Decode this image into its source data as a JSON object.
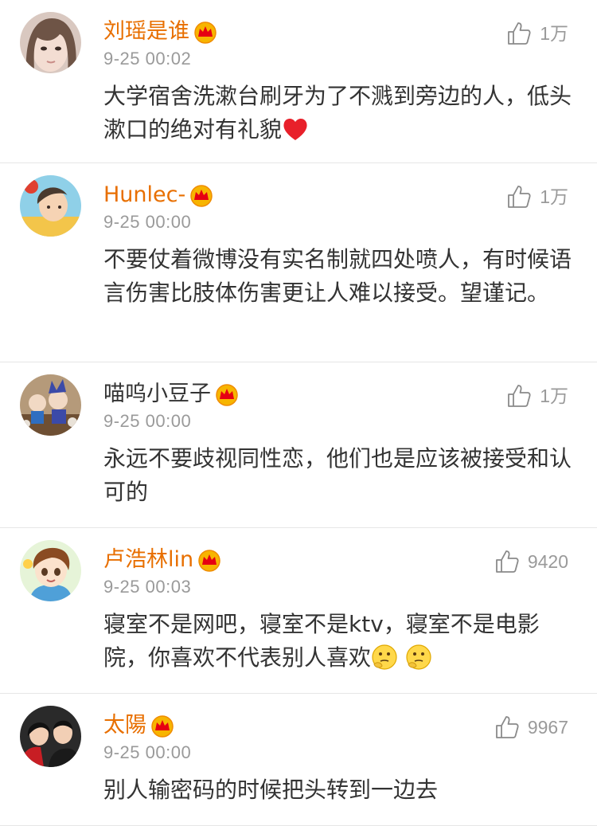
{
  "accent_username_color": "#e86f00",
  "comments": [
    {
      "username": "刘瑶是谁",
      "username_color": "#e86f00",
      "time": "9-25 00:02",
      "likes": "1万",
      "text": "大学宿舍洗漱台刷牙为了不溅到旁边的人，低头漱口的绝对有礼貌",
      "emojis": [
        "red-heart"
      ],
      "avatar": "girl-avatar"
    },
    {
      "username": "Hunlec-",
      "username_color": "#e86f00",
      "time": "9-25 00:00",
      "likes": "1万",
      "text": "不要仗着微博没有实名制就四处喷人，有时候语言伤害比肢体伤害更让人难以接受。望谨记。",
      "emojis": [],
      "avatar": "cartoon-boy-avatar"
    },
    {
      "username": "喵呜小豆子",
      "username_color": "#333333",
      "time": "9-25 00:00",
      "likes": "1万",
      "text": "永远不要歧视同性恋，他们也是应该被接受和认可的",
      "emojis": [],
      "avatar": "dolls-avatar"
    },
    {
      "username": "卢浩林lin",
      "username_color": "#e86f00",
      "time": "9-25 00:03",
      "likes": "9420",
      "text": "寝室不是网吧，寝室不是ktv，寝室不是电影院，你喜欢不代表别人喜欢",
      "emojis": [
        "thinking-face",
        "thinking-face"
      ],
      "avatar": "anime-boy-avatar"
    },
    {
      "username": "太陽",
      "username_color": "#e86f00",
      "time": "9-25 00:00",
      "likes": "9967",
      "text": "别人输密码的时候把头转到一边去",
      "emojis": [],
      "avatar": "couple-avatar"
    }
  ]
}
